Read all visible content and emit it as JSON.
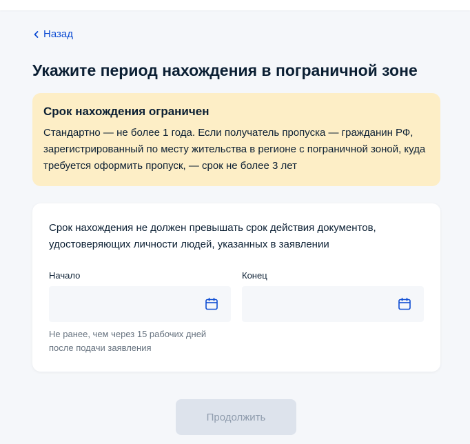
{
  "nav": {
    "back_label": "Назад"
  },
  "page": {
    "title": "Укажите период нахождения в пограничной зоне"
  },
  "warning": {
    "title": "Срок нахождения ограничен",
    "text": "Стандартно — не более 1 года. Если получатель пропуска — гражданин РФ, зарегистрированный по месту жительства в регионе с пограничной зоной, куда требуется оформить пропуск, — срок не более 3 лет"
  },
  "form": {
    "note": "Срок нахождения не должен превышать срок действия документов, удостоверяющих личности людей, указанных в заявлении",
    "start": {
      "label": "Начало",
      "value": "",
      "hint": "Не ранее, чем через 15 рабочих дней после подачи заявления"
    },
    "end": {
      "label": "Конец",
      "value": ""
    }
  },
  "actions": {
    "continue_label": "Продолжить",
    "continue_enabled": false
  },
  "colors": {
    "accent": "#0d4cd3",
    "warning_bg": "#fdeec6",
    "page_bg": "#f5f7fa",
    "disabled_button_bg": "#dde3ec"
  },
  "icons": {
    "back": "chevron-left-icon",
    "calendar": "calendar-icon"
  }
}
